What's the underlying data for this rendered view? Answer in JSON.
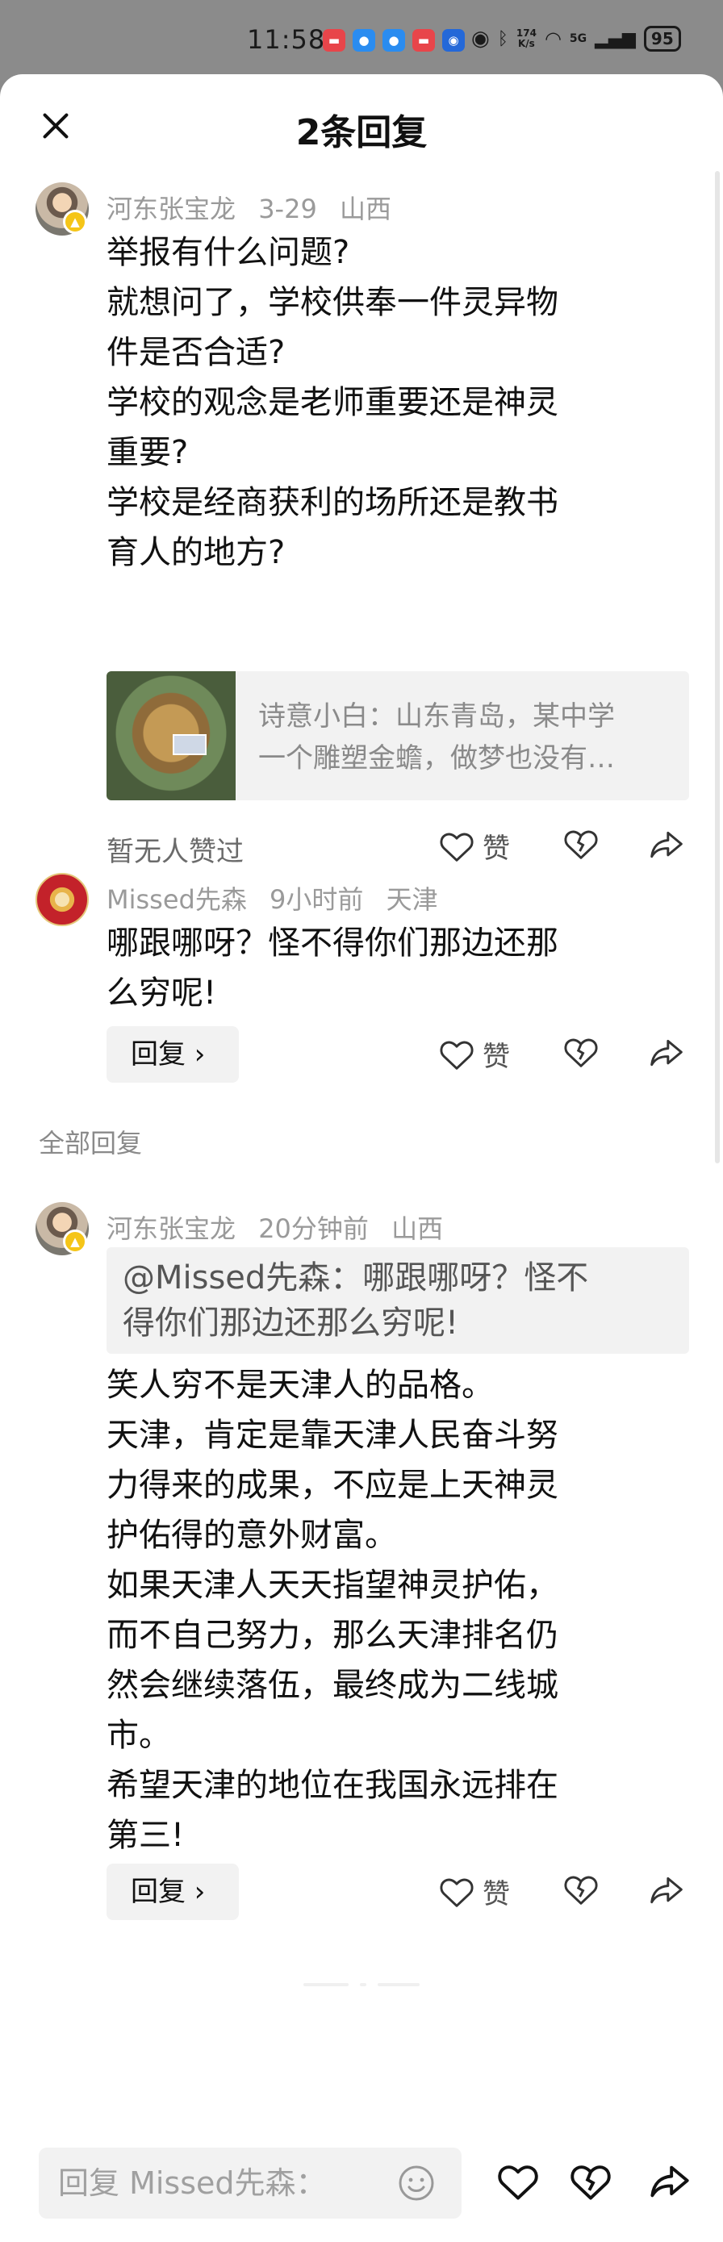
{
  "status_bar": {
    "time": "11:58",
    "net_speed_value": "174",
    "net_speed_unit": "K/s",
    "network": "5G",
    "battery": "95"
  },
  "header": {
    "title": "2条回复"
  },
  "comments": [
    {
      "author": "河东张宝龙",
      "date": "3-29",
      "location": "山西",
      "lines": [
        "举报有什么问题?",
        "就想问了，学校供奉一件灵异物",
        "件是否合适?",
        "学校的观念是老师重要还是神灵",
        "重要?",
        "学校是经商获利的场所还是教书",
        "育人的地方?"
      ],
      "link_card": {
        "line1": "诗意小白：山东青岛，某中学",
        "line2": "一个雕塑金蟾，做梦也没有…"
      },
      "no_likes": "暂无人赞过",
      "like_label": "赞"
    },
    {
      "author": "Missed先森",
      "date": "9小时前",
      "location": "天津",
      "lines": [
        "哪跟哪呀？怪不得你们那边还那",
        "么穷呢!"
      ],
      "reply_label": "回复 ›",
      "like_label": "赞"
    },
    {
      "author": "河东张宝龙",
      "date": "20分钟前",
      "location": "山西",
      "quote_lines": [
        "@Missed先森：哪跟哪呀？怪不",
        "得你们那边还那么穷呢!"
      ],
      "lines": [
        "笑人穷不是天津人的品格。",
        "天津，肯定是靠天津人民奋斗努",
        "力得来的成果，不应是上天神灵",
        "护佑得的意外财富。",
        "如果天津人天天指望神灵护佑，",
        "而不自己努力，那么天津排名仍",
        "然会继续落伍，最终成为二线城",
        "市。",
        "希望天津的地位在我国永远排在",
        "第三!"
      ],
      "reply_label": "回复 ›",
      "like_label": "赞"
    }
  ],
  "section_label": "全部回复",
  "bottom_bar": {
    "input_placeholder": "回复 Missed先森："
  }
}
